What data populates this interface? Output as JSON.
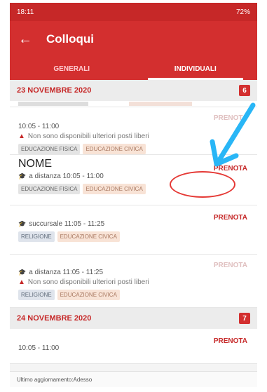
{
  "statusbar": {
    "time": "18:11",
    "right": "72%"
  },
  "appbar": {
    "back": "←",
    "title": "Colloqui"
  },
  "tabs": [
    {
      "label": "GENERALI",
      "active": false
    },
    {
      "label": "INDIVIDUALI",
      "active": true
    }
  ],
  "day1": {
    "date": "23 NOVEMBRE 2020",
    "count": "6",
    "cards": [
      {
        "time": "10:05 - 11:00",
        "warning": "Non sono disponibili ulteriori posti liberi",
        "action": "PRENOTA",
        "tags": [
          "EDUCAZIONE FISICA",
          "EDUCAZIONE CIVICA"
        ]
      },
      {
        "name": "NOME",
        "time": "a distanza 10:05 - 11:00",
        "action": "PRENOTA",
        "tags": [
          "EDUCAZIONE FISICA",
          "EDUCAZIONE CIVICA"
        ]
      },
      {
        "time": "succursale 11:05 - 11:25",
        "action": "PRENOTA",
        "tags": [
          "RELIGIONE",
          "EDUCAZIONE CIVICA"
        ]
      },
      {
        "time": "a distanza 11:05 - 11:25",
        "warning": "Non sono disponibili ulteriori posti liberi",
        "action": "PRENOTA",
        "tags": [
          "RELIGIONE",
          "EDUCAZIONE CIVICA"
        ]
      }
    ]
  },
  "day2": {
    "date": "24 NOVEMBRE 2020",
    "count": "7",
    "card": {
      "time": "10:05 - 11:00",
      "action": "PRENOTA"
    }
  },
  "footer": "Ultimo aggiornamento:Adesso",
  "colors": {
    "primary": "#d32f2f",
    "arrow": "#29b6f6",
    "oval": "#e53935"
  }
}
